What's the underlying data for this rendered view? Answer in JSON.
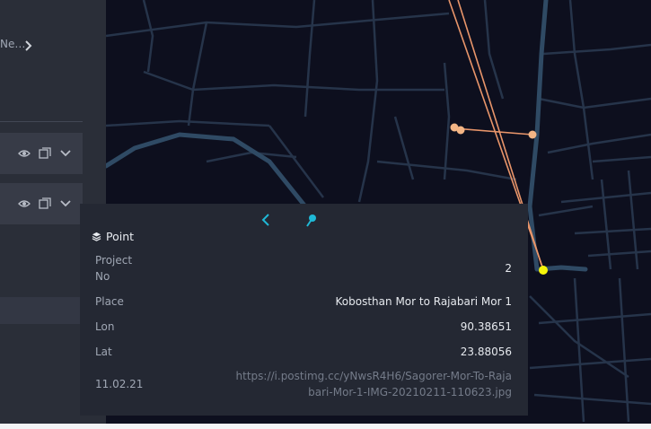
{
  "sidebar": {
    "breadcrumb_text": "Ne…",
    "breadcrumb_icon": "chevron-right-icon",
    "layers": [
      {
        "icons": [
          "eye-icon",
          "copy-icon",
          "chevron-down-icon"
        ]
      },
      {
        "icons": [
          "eye-icon",
          "copy-icon",
          "chevron-down-icon"
        ]
      }
    ]
  },
  "map": {
    "background_color": "#0d0f1e",
    "road_color": "#26344a",
    "highway_color": "#2f4a64",
    "line_color": "#e8956a",
    "point_color": "#f3b585",
    "selected_point_color": "#f5f50a"
  },
  "tooltip": {
    "title": "Point",
    "title_icon": "layers-icon",
    "nav_back_icon": "chevron-left-icon",
    "pin_icon": "pin-icon",
    "accent_color": "#1fb8d6",
    "fields": [
      {
        "label": "Project No",
        "value": "2"
      },
      {
        "label": "Place",
        "value": "Kobosthan Mor to Rajabari Mor 1"
      },
      {
        "label": "Lon",
        "value": "90.38651"
      },
      {
        "label": "Lat",
        "value": "23.88056"
      },
      {
        "label": "11.02.21",
        "value": "https://i.postimg.cc/yNwsR4H6/Sagorer-Mor-To-Rajabari-Mor-1-IMG-20210211-110623.jpg"
      }
    ]
  }
}
